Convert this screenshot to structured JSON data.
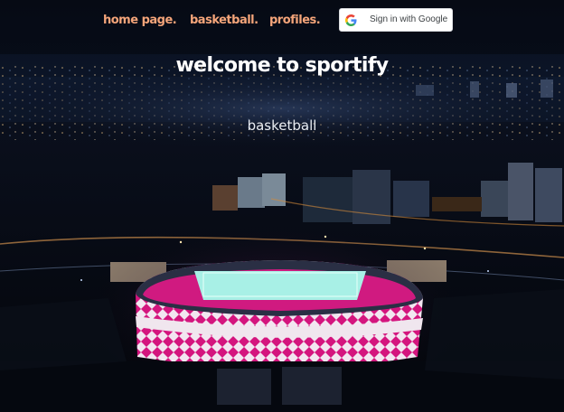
{
  "nav": {
    "links": [
      {
        "label": "home page."
      },
      {
        "label": "basketball."
      },
      {
        "label": "profiles."
      }
    ],
    "google_signin_label": "Sign in with Google"
  },
  "hero": {
    "title": "welcome to sportify",
    "subtitle": "basketball"
  },
  "colors": {
    "nav_link": "#f5a57a",
    "title": "#ffffff",
    "subtitle": "#e8ecf2",
    "stadium_accent": "#e0208a",
    "pitch": "#a8f0e6",
    "background": "#05070f"
  },
  "icons": {
    "google": "google-g-icon"
  }
}
